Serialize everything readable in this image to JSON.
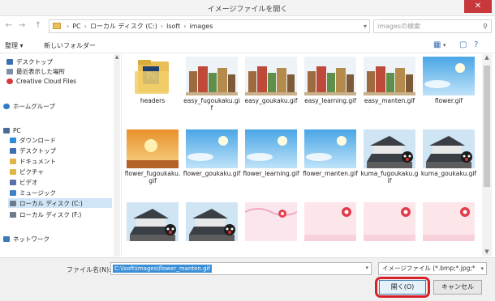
{
  "window": {
    "title": "イメージファイルを開く",
    "close_glyph": "✕"
  },
  "nav_buttons": {
    "back": "←",
    "forward": "→",
    "up": "↑"
  },
  "address": {
    "segments": [
      "PC",
      "ローカル ディスク (C:)",
      "lsoft",
      "images"
    ],
    "separator": "›"
  },
  "search": {
    "placeholder": "imagesの検索",
    "icon": "search-icon"
  },
  "toolbar": {
    "organize": "整理 ▾",
    "new_folder": "新しいフォルダー"
  },
  "nav_pane": {
    "items": [
      {
        "label": "デスクトップ",
        "icon": "desktop-icon",
        "color": "#3a6fb0"
      },
      {
        "label": "最近表示した場所",
        "icon": "recent-places-icon",
        "color": "#7a8fa8"
      },
      {
        "label": "Creative Cloud Files",
        "icon": "creative-cloud-icon",
        "color": "#d7373f"
      },
      {
        "label": "ホームグループ",
        "icon": "homegroup-icon",
        "color": "#2e7bc4"
      },
      {
        "label": "PC",
        "icon": "pc-icon",
        "color": "#4a6b9a"
      },
      {
        "label": "ダウンロード",
        "icon": "downloads-icon",
        "color": "#2f8ad6"
      },
      {
        "label": "デスクトップ",
        "icon": "desktop-icon",
        "color": "#3a6fb0"
      },
      {
        "label": "ドキュメント",
        "icon": "documents-icon",
        "color": "#e1b545"
      },
      {
        "label": "ピクチャ",
        "icon": "pictures-icon",
        "color": "#e1b545"
      },
      {
        "label": "ビデオ",
        "icon": "videos-icon",
        "color": "#5a6ea8"
      },
      {
        "label": "ミュージック",
        "icon": "music-icon",
        "color": "#3b82c7"
      },
      {
        "label": "ローカル ディスク (C:)",
        "icon": "drive-icon",
        "color": "#6d7b8d"
      },
      {
        "label": "ローカル ディスク (F:)",
        "icon": "drive-icon",
        "color": "#6d7b8d"
      },
      {
        "label": "ネットワーク",
        "icon": "network-icon",
        "color": "#3d79b8"
      }
    ]
  },
  "files": [
    {
      "label": "headers",
      "kind": "folder"
    },
    {
      "label": "easy_fugoukaku.gif",
      "kind": "books"
    },
    {
      "label": "easy_goukaku.gif",
      "kind": "books"
    },
    {
      "label": "easy_learning.gif",
      "kind": "books"
    },
    {
      "label": "easy_manten.gif",
      "kind": "books"
    },
    {
      "label": "flower.gif",
      "kind": "sky"
    },
    {
      "label": "flower_fugoukaku.gif",
      "kind": "sunset"
    },
    {
      "label": "flower_goukaku.gif",
      "kind": "sky"
    },
    {
      "label": "flower_learning.gif",
      "kind": "sky"
    },
    {
      "label": "flower_manten.gif",
      "kind": "sky"
    },
    {
      "label": "kuma_fugoukaku.gif",
      "kind": "castle"
    },
    {
      "label": "kuma_goukaku.gif",
      "kind": "castle"
    },
    {
      "label": "",
      "kind": "castle"
    },
    {
      "label": "",
      "kind": "castle"
    },
    {
      "label": "",
      "kind": "pinkpattern"
    },
    {
      "label": "",
      "kind": "pink"
    },
    {
      "label": "",
      "kind": "pink"
    },
    {
      "label": "",
      "kind": "pink"
    }
  ],
  "bottom": {
    "filename_label": "ファイル名(N):",
    "filename_value": "C:\\lsoft\\images\\flower_manten.gif",
    "filetype_value": "イメージファイル (*.bmp;*.jpg;*",
    "open_button": "開く(O)",
    "cancel_button": "キャンセル"
  },
  "colors": {
    "highlight_ring": "#d8202b",
    "selection": "#3b8fd6"
  }
}
